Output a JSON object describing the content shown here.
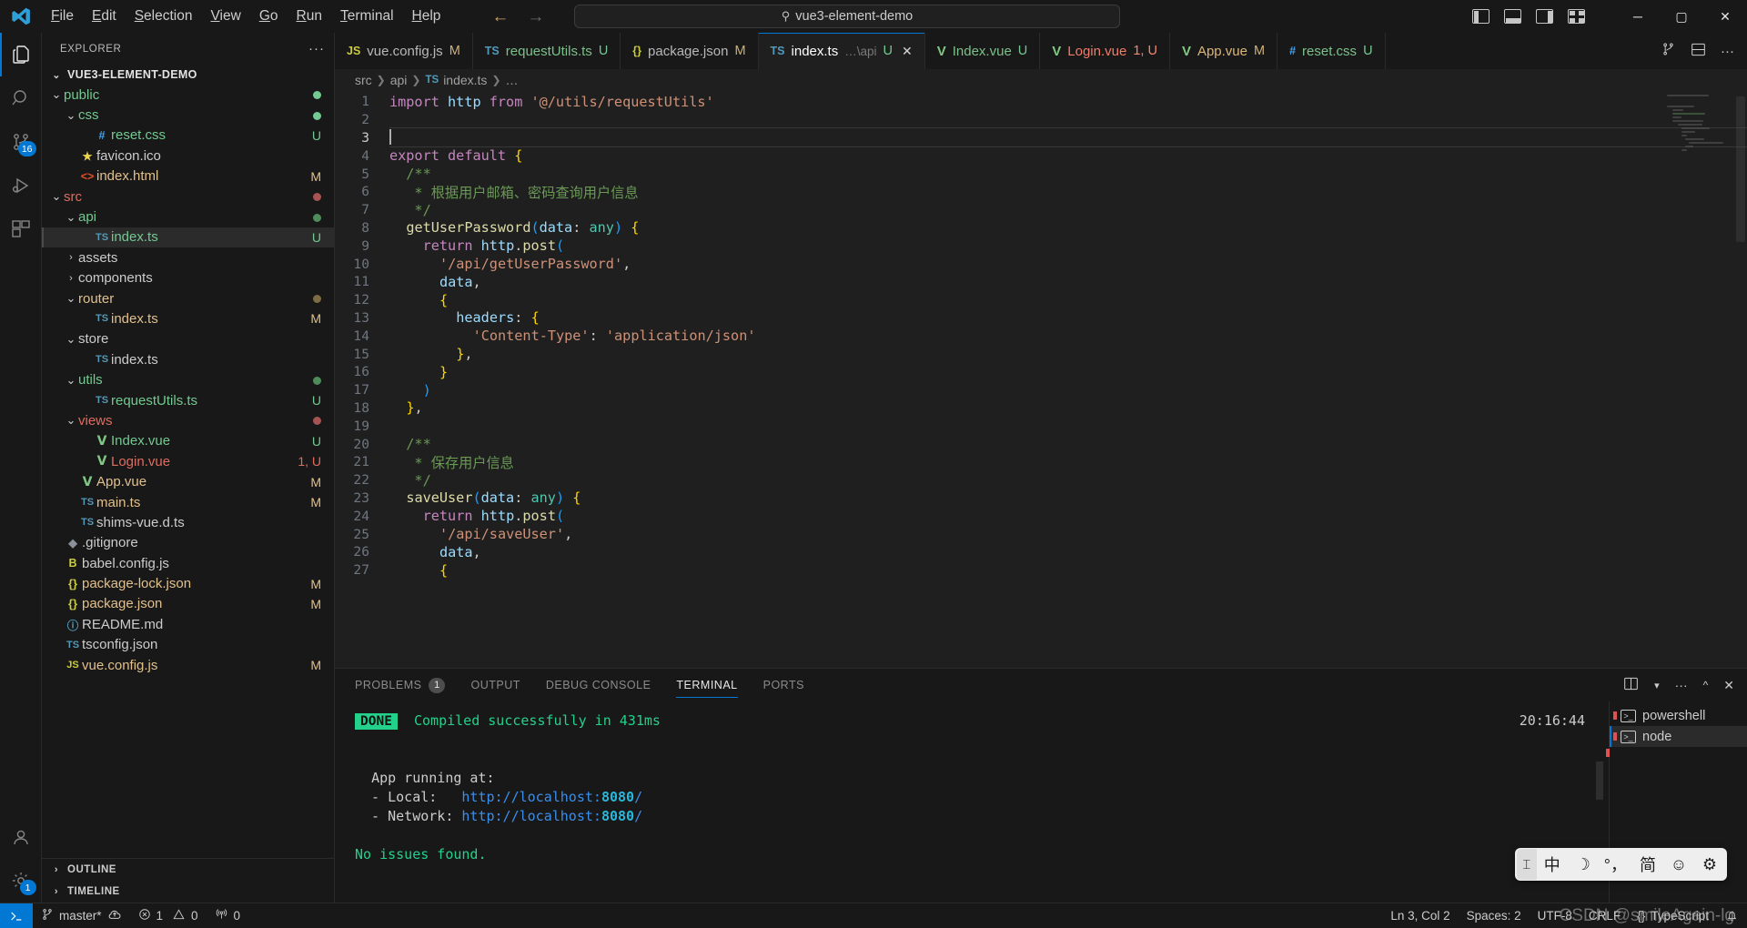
{
  "titlebar": {
    "menus": [
      "File",
      "Edit",
      "Selection",
      "View",
      "Go",
      "Run",
      "Terminal",
      "Help"
    ],
    "back_arrow": "←",
    "forward_arrow": "→",
    "command_center": {
      "icon": "search-icon",
      "text": "vue3-element-demo"
    },
    "window_controls": {
      "minimize": "─",
      "maximize": "▢",
      "close": "✕"
    }
  },
  "activitybar": {
    "items": [
      {
        "name": "explorer",
        "icon": "files-icon",
        "badge": ""
      },
      {
        "name": "search",
        "icon": "search-icon",
        "badge": ""
      },
      {
        "name": "source-control",
        "icon": "source-control-icon",
        "badge": "16"
      },
      {
        "name": "run-and-debug",
        "icon": "debug-icon",
        "badge": ""
      },
      {
        "name": "extensions",
        "icon": "extensions-icon",
        "badge": ""
      }
    ],
    "bottom": [
      {
        "name": "accounts",
        "icon": "account-icon",
        "badge": ""
      },
      {
        "name": "settings",
        "icon": "gear-icon",
        "badge": "1"
      }
    ]
  },
  "explorer": {
    "title": "EXPLORER",
    "more_actions": "···",
    "root": {
      "label": "VUE3-ELEMENT-DEMO",
      "chevron": "⌄"
    },
    "tree": [
      {
        "indent": 1,
        "chevron": "⌄",
        "icon": "",
        "icon_class": "",
        "label": "public",
        "label_color": "#73c991",
        "status": "●",
        "status_color": "#73c991",
        "selected": false
      },
      {
        "indent": 2,
        "chevron": "⌄",
        "icon": "",
        "icon_class": "",
        "label": "css",
        "label_color": "#73c991",
        "status": "●",
        "status_color": "#73c991",
        "selected": false
      },
      {
        "indent": 3,
        "chevron": "",
        "icon": "#",
        "icon_class": "css-ico",
        "label": "reset.css",
        "label_color": "#73c991",
        "status": "U",
        "status_color": "#73c991",
        "selected": false
      },
      {
        "indent": 2,
        "chevron": "",
        "icon": "★",
        "icon_class": "js-ico",
        "label": "favicon.ico",
        "label_color": "#cccccc",
        "status": "",
        "status_color": "",
        "selected": false
      },
      {
        "indent": 2,
        "chevron": "",
        "icon": "<>",
        "icon_class": "html-ico",
        "label": "index.html",
        "label_color": "#e2c08d",
        "status": "M",
        "status_color": "#e2c08d",
        "selected": false
      },
      {
        "indent": 1,
        "chevron": "⌄",
        "icon": "",
        "icon_class": "",
        "label": "src",
        "label_color": "#e06c60",
        "status": "●",
        "status_color": "#a55353",
        "selected": false
      },
      {
        "indent": 2,
        "chevron": "⌄",
        "icon": "",
        "icon_class": "",
        "label": "api",
        "label_color": "#73c991",
        "status": "●",
        "status_color": "#4f8c5c",
        "selected": false
      },
      {
        "indent": 3,
        "chevron": "",
        "icon": "TS",
        "icon_class": "ts-ico",
        "label": "index.ts",
        "label_color": "#73c991",
        "status": "U",
        "status_color": "#73c991",
        "selected": true
      },
      {
        "indent": 2,
        "chevron": "›",
        "icon": "",
        "icon_class": "",
        "label": "assets",
        "label_color": "#cccccc",
        "status": "",
        "status_color": "",
        "selected": false
      },
      {
        "indent": 2,
        "chevron": "›",
        "icon": "",
        "icon_class": "",
        "label": "components",
        "label_color": "#cccccc",
        "status": "",
        "status_color": "",
        "selected": false
      },
      {
        "indent": 2,
        "chevron": "⌄",
        "icon": "",
        "icon_class": "",
        "label": "router",
        "label_color": "#e2c08d",
        "status": "●",
        "status_color": "#7d6b44",
        "selected": false
      },
      {
        "indent": 3,
        "chevron": "",
        "icon": "TS",
        "icon_class": "ts-ico",
        "label": "index.ts",
        "label_color": "#e2c08d",
        "status": "M",
        "status_color": "#e2c08d",
        "selected": false
      },
      {
        "indent": 2,
        "chevron": "⌄",
        "icon": "",
        "icon_class": "",
        "label": "store",
        "label_color": "#cccccc",
        "status": "",
        "status_color": "",
        "selected": false
      },
      {
        "indent": 3,
        "chevron": "",
        "icon": "TS",
        "icon_class": "ts-ico",
        "label": "index.ts",
        "label_color": "#cccccc",
        "status": "",
        "status_color": "",
        "selected": false
      },
      {
        "indent": 2,
        "chevron": "⌄",
        "icon": "",
        "icon_class": "",
        "label": "utils",
        "label_color": "#73c991",
        "status": "●",
        "status_color": "#4f8c5c",
        "selected": false
      },
      {
        "indent": 3,
        "chevron": "",
        "icon": "TS",
        "icon_class": "ts-ico",
        "label": "requestUtils.ts",
        "label_color": "#73c991",
        "status": "U",
        "status_color": "#73c991",
        "selected": false
      },
      {
        "indent": 2,
        "chevron": "⌄",
        "icon": "",
        "icon_class": "",
        "label": "views",
        "label_color": "#e06c60",
        "status": "●",
        "status_color": "#a55353",
        "selected": false
      },
      {
        "indent": 3,
        "chevron": "",
        "icon": "V",
        "icon_class": "vue-ico",
        "label": "Index.vue",
        "label_color": "#73c991",
        "status": "U",
        "status_color": "#73c991",
        "selected": false
      },
      {
        "indent": 3,
        "chevron": "",
        "icon": "V",
        "icon_class": "vue-ico",
        "label": "Login.vue",
        "label_color": "#e06c60",
        "status": "1, U",
        "status_color": "#e06c60",
        "selected": false
      },
      {
        "indent": 2,
        "chevron": "",
        "icon": "V",
        "icon_class": "vue-ico",
        "label": "App.vue",
        "label_color": "#e2c08d",
        "status": "M",
        "status_color": "#e2c08d",
        "selected": false
      },
      {
        "indent": 2,
        "chevron": "",
        "icon": "TS",
        "icon_class": "ts-ico",
        "label": "main.ts",
        "label_color": "#e2c08d",
        "status": "M",
        "status_color": "#e2c08d",
        "selected": false
      },
      {
        "indent": 2,
        "chevron": "",
        "icon": "TS",
        "icon_class": "ts-ico",
        "label": "shims-vue.d.ts",
        "label_color": "#cccccc",
        "status": "",
        "status_color": "",
        "selected": false
      },
      {
        "indent": 1,
        "chevron": "",
        "icon": "◆",
        "icon_class": "git-ico",
        "label": ".gitignore",
        "label_color": "#cccccc",
        "status": "",
        "status_color": "",
        "selected": false
      },
      {
        "indent": 1,
        "chevron": "",
        "icon": "B",
        "icon_class": "js-ico",
        "label": "babel.config.js",
        "label_color": "#cccccc",
        "status": "",
        "status_color": "",
        "selected": false
      },
      {
        "indent": 1,
        "chevron": "",
        "icon": "{}",
        "icon_class": "json-ico",
        "label": "package-lock.json",
        "label_color": "#e2c08d",
        "status": "M",
        "status_color": "#e2c08d",
        "selected": false
      },
      {
        "indent": 1,
        "chevron": "",
        "icon": "{}",
        "icon_class": "json-ico",
        "label": "package.json",
        "label_color": "#e2c08d",
        "status": "M",
        "status_color": "#e2c08d",
        "selected": false
      },
      {
        "indent": 1,
        "chevron": "",
        "icon": "ⓘ",
        "icon_class": "md-ico",
        "label": "README.md",
        "label_color": "#cccccc",
        "status": "",
        "status_color": "",
        "selected": false
      },
      {
        "indent": 1,
        "chevron": "",
        "icon": "TS",
        "icon_class": "ts-ico",
        "label": "tsconfig.json",
        "label_color": "#cccccc",
        "status": "",
        "status_color": "",
        "selected": false
      },
      {
        "indent": 1,
        "chevron": "",
        "icon": "JS",
        "icon_class": "js-ico",
        "label": "vue.config.js",
        "label_color": "#e2c08d",
        "status": "M",
        "status_color": "#e2c08d",
        "selected": false
      }
    ],
    "sections": [
      {
        "label": "OUTLINE",
        "chevron": "›"
      },
      {
        "label": "TIMELINE",
        "chevron": "›"
      }
    ]
  },
  "tabs": [
    {
      "icon": "JS",
      "icon_class": "js-ico",
      "label": "vue.config.js",
      "sub": "",
      "tag": "M",
      "tag_class": "tagm",
      "active": false,
      "name_class": ""
    },
    {
      "icon": "TS",
      "icon_class": "ts-ico",
      "label": "requestUtils.ts",
      "sub": "",
      "tag": "U",
      "tag_class": "tagu",
      "active": false,
      "name_class": "modified-name"
    },
    {
      "icon": "{}",
      "icon_class": "json-ico",
      "label": "package.json",
      "sub": "",
      "tag": "M",
      "tag_class": "tagm",
      "active": false,
      "name_class": ""
    },
    {
      "icon": "V",
      "icon_class": "vue-ico",
      "label": "index.ts",
      "sub": "…\\api",
      "tag": "U",
      "tag_class": "tagu",
      "active": true,
      "name_class": "",
      "icon_override": "TS",
      "icon_class_override": "ts-ico",
      "close": "✕"
    },
    {
      "icon": "V",
      "icon_class": "vue-ico",
      "label": "Index.vue",
      "sub": "",
      "tag": "U",
      "tag_class": "tagu",
      "active": false,
      "name_class": ""
    },
    {
      "icon": "V",
      "icon_class": "vue-ico",
      "label": "Login.vue",
      "sub": "",
      "tag": "1, U",
      "tag_class": "tagerr",
      "active": false,
      "name_class": "error-name"
    },
    {
      "icon": "V",
      "icon_class": "vue-ico",
      "label": "App.vue",
      "sub": "",
      "tag": "M",
      "tag_class": "tagm",
      "active": false,
      "name_class": "modified-name"
    },
    {
      "icon": "#",
      "icon_class": "css-ico",
      "label": "reset.css",
      "sub": "",
      "tag": "U",
      "tag_class": "tagu",
      "active": false,
      "name_class": ""
    }
  ],
  "tab_actions": {
    "split_editor": "split-editor-icon",
    "layout": "editor-layout-icon",
    "more": "···"
  },
  "breadcrumb": [
    "src",
    "api",
    "index.ts",
    "…"
  ],
  "editor": {
    "language": "TypeScript",
    "lines": [
      {
        "n": "1",
        "cur": false
      },
      {
        "n": "2",
        "cur": false
      },
      {
        "n": "3",
        "cur": true
      },
      {
        "n": "4",
        "cur": false
      },
      {
        "n": "5",
        "cur": false
      },
      {
        "n": "6",
        "cur": false
      },
      {
        "n": "7",
        "cur": false
      },
      {
        "n": "8",
        "cur": false
      },
      {
        "n": "9",
        "cur": false
      },
      {
        "n": "10",
        "cur": false
      },
      {
        "n": "11",
        "cur": false
      },
      {
        "n": "12",
        "cur": false
      },
      {
        "n": "13",
        "cur": false
      },
      {
        "n": "14",
        "cur": false
      },
      {
        "n": "15",
        "cur": false
      },
      {
        "n": "16",
        "cur": false
      },
      {
        "n": "17",
        "cur": false
      },
      {
        "n": "18",
        "cur": false
      },
      {
        "n": "19",
        "cur": false
      },
      {
        "n": "20",
        "cur": false
      },
      {
        "n": "21",
        "cur": false
      },
      {
        "n": "22",
        "cur": false
      },
      {
        "n": "23",
        "cur": false
      },
      {
        "n": "24",
        "cur": false
      },
      {
        "n": "25",
        "cur": false
      },
      {
        "n": "26",
        "cur": false
      },
      {
        "n": "27",
        "cur": false
      }
    ],
    "code_text": [
      "import http from '@/utils/requestUtils'",
      "",
      "",
      "export default {",
      "  /**",
      "   * 根据用户邮箱、密码查询用户信息",
      "   */",
      "  getUserPassword(data: any) {",
      "    return http.post(",
      "      '/api/getUserPassword',",
      "      data,",
      "      {",
      "        headers: {",
      "          'Content-Type': 'application/json'",
      "        },",
      "      }",
      "    )",
      "  },",
      "",
      "  /**",
      "   * 保存用户信息",
      "   */",
      "  saveUser(data: any) {",
      "    return http.post(",
      "      '/api/saveUser',",
      "      data,",
      "      {"
    ]
  },
  "panel": {
    "tabs": [
      {
        "label": "PROBLEMS",
        "badge": "1",
        "active": false
      },
      {
        "label": "OUTPUT",
        "badge": "",
        "active": false
      },
      {
        "label": "DEBUG CONSOLE",
        "badge": "",
        "active": false
      },
      {
        "label": "TERMINAL",
        "badge": "",
        "active": true
      },
      {
        "label": "PORTS",
        "badge": "",
        "active": false
      }
    ],
    "actions": [
      "split-terminal-icon",
      "chevron-down-icon",
      "more-icon",
      "chevron-up-icon",
      "close-icon"
    ],
    "terminal": {
      "badge": "DONE",
      "compiled": "Compiled successfully in 431ms",
      "timestamp": "20:16:44",
      "app_running": "App running at:",
      "local_label": "  - Local:   ",
      "local_url_base": "http://localhost:",
      "local_port": "8080",
      "local_url_tail": "/",
      "network_label": "  - Network: ",
      "network_url_base": "http://localhost:",
      "network_port": "8080",
      "network_url_tail": "/",
      "no_issues": "No issues found."
    },
    "instances": [
      {
        "label": "powershell",
        "active": false
      },
      {
        "label": "node",
        "active": true
      }
    ]
  },
  "statusbar": {
    "remote_icon": "remote-window-icon",
    "branch": "master*",
    "sync_icon": "sync-cloud-icon",
    "errors": "1",
    "warnings": "0",
    "ports": "0",
    "position": "Ln 3, Col 2",
    "spaces": "Spaces: 2",
    "encoding": "UTF-8",
    "eol": "CRLF",
    "language": "TypeScript",
    "bell_icon": "bell-icon"
  },
  "watermark": "CSDN @smileAgain-lg",
  "ime": {
    "handle": "⌶",
    "cells": [
      "中",
      "☽",
      "°，",
      "简",
      "☺",
      "⚙"
    ]
  }
}
